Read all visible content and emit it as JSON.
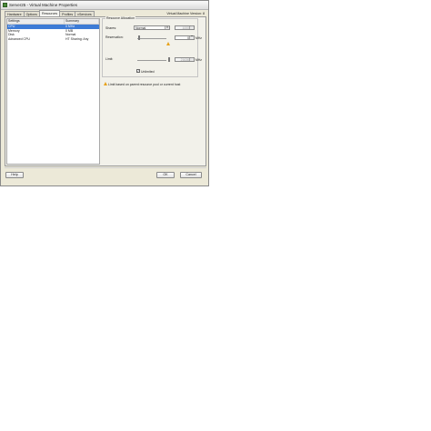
{
  "window": {
    "title": "Server25 - Virtual Machine Properties"
  },
  "tabs": [
    "Hardware",
    "Options",
    "Resources",
    "Profiles",
    "vServices"
  ],
  "active_tab": "Resources",
  "vm_version": "Virtual Machine Version: 8",
  "list": {
    "headers": [
      "Settings",
      "Summary"
    ],
    "rows": [
      {
        "setting": "CPU",
        "summary": "0 MHz",
        "selected": true
      },
      {
        "setting": "Memory",
        "summary": "0 MB",
        "selected": false
      },
      {
        "setting": "Disk",
        "summary": "Normal",
        "selected": false
      },
      {
        "setting": "Advanced CPU",
        "summary": "HT Sharing: Any",
        "selected": false
      }
    ]
  },
  "resource_allocation": {
    "group_title": "Resource Allocation",
    "shares": {
      "label": "Shares:",
      "value": "Normal",
      "amount": "1000"
    },
    "reservation": {
      "label": "Reservation:",
      "value": "0",
      "unit": "MHz"
    },
    "limit": {
      "label": "Limit:",
      "value": "21636",
      "unit": "MHz"
    },
    "unlimited": {
      "label": "Unlimited",
      "checked": true
    }
  },
  "warning": {
    "text": "Limit based on parent resource pool or current host"
  },
  "buttons": {
    "help": "Help",
    "ok": "OK",
    "cancel": "Cancel"
  },
  "colors": {
    "accent_selection": "#3d7bd6",
    "warning": "#e8a21a"
  }
}
